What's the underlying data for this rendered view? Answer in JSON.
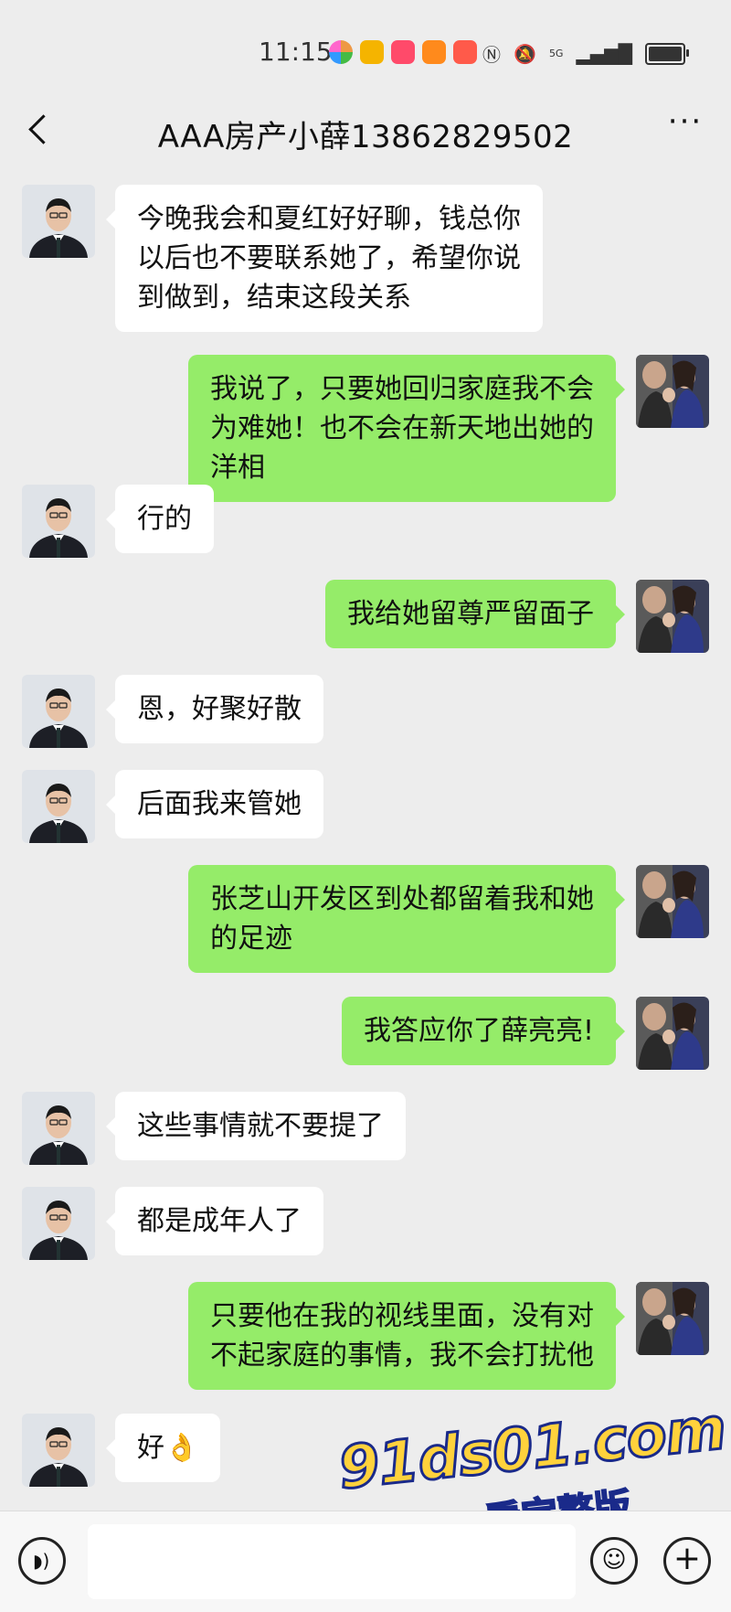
{
  "status_bar": {
    "time": "11:15",
    "network": "5G"
  },
  "header": {
    "title": "AAA房产小薛13862829502",
    "more": "···"
  },
  "messages": [
    {
      "side": "in",
      "text": "今晚我会和夏红好好聊，钱总你以后也不要联系她了，希望你说到做到，结束这段关系"
    },
    {
      "side": "out",
      "text": "我说了，只要她回归家庭我不会为难她！也不会在新天地出她的洋相"
    },
    {
      "side": "in",
      "text": "行的"
    },
    {
      "side": "out",
      "text": "我给她留尊严留面子"
    },
    {
      "side": "in",
      "text": "恩，好聚好散"
    },
    {
      "side": "in",
      "text": "后面我来管她"
    },
    {
      "side": "out",
      "text": "张芝山开发区到处都留着我和她的足迹"
    },
    {
      "side": "out",
      "text": "我答应你了薛亮亮!"
    },
    {
      "side": "in",
      "text": "这些事情就不要提了"
    },
    {
      "side": "in",
      "text": "都是成年人了"
    },
    {
      "side": "out",
      "text": "只要他在我的视线里面，没有对不起家庭的事情，我不会打扰他"
    },
    {
      "side": "in",
      "text": "好👌"
    }
  ],
  "watermark": {
    "site": "91ds01.com",
    "caption": "看完整版"
  },
  "colors": {
    "background": "#ededed",
    "bubble_in": "#ffffff",
    "bubble_out": "#95ec69"
  }
}
